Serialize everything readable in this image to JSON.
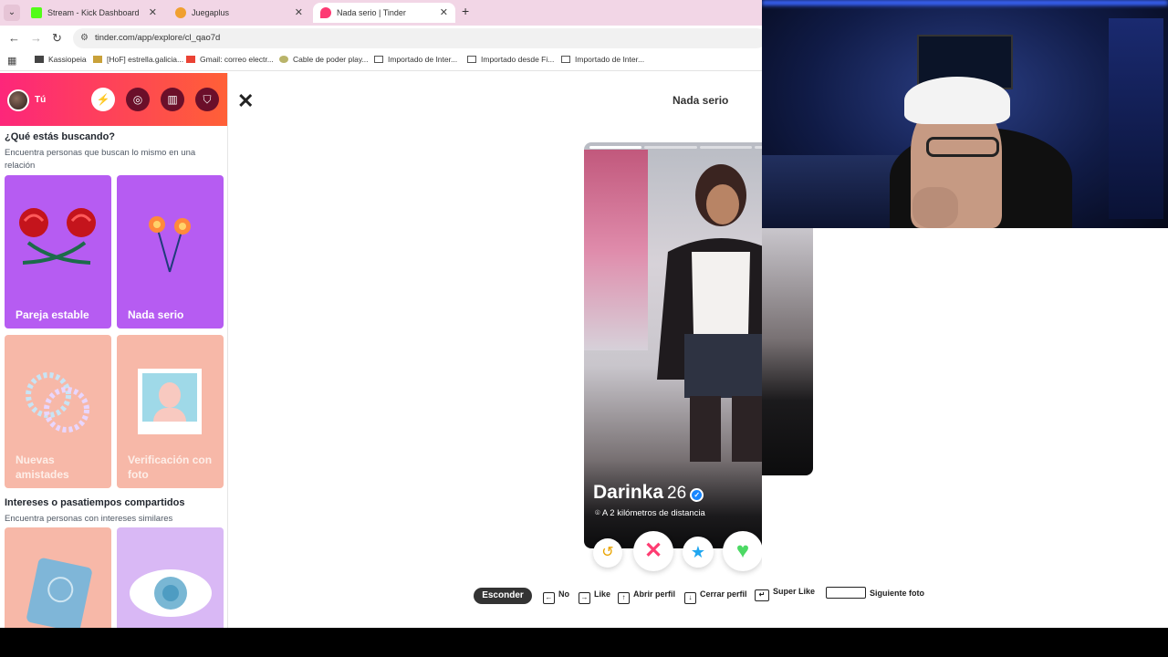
{
  "browser": {
    "tabs": [
      {
        "title": "Stream - Kick Dashboard",
        "fav_color": "#53fc18"
      },
      {
        "title": "Juegaplus",
        "fav_color": "#f0a030"
      },
      {
        "title": "Nada serio | Tinder",
        "fav_color": "#fd3a73"
      }
    ],
    "url": "tinder.com/app/explore/cl_qao7d",
    "bookmarks": [
      "Kassiopeia",
      "[HoF] estrella.galicia...",
      "Gmail: correo electr...",
      "Cable de poder play...",
      "Importado de Inter...",
      "Importado desde Fi...",
      "Importado de Inter..."
    ]
  },
  "sidebar": {
    "you_label": "Tú",
    "section1_title": "¿Qué estás buscando?",
    "section1_sub": "Encuentra personas que buscan lo mismo en una relación",
    "cards1": [
      {
        "label": "Pareja estable"
      },
      {
        "label": "Nada serio"
      },
      {
        "label": "Nuevas amistades"
      },
      {
        "label": "Verificación con foto"
      }
    ],
    "section2_title": "Intereses o pasatiempos compartidos",
    "section2_sub": "Encuentra personas con intereses similares"
  },
  "main": {
    "title": "Nada serio",
    "profile": {
      "name": "Darinka",
      "age": "26",
      "distance": "A 2 kilómetros de distancia"
    },
    "shortcuts": {
      "hide": "Esconder",
      "no": "No",
      "like": "Like",
      "open": "Abrir perfil",
      "close": "Cerrar perfil",
      "super": "Super Like",
      "next": "Siguiente foto"
    }
  },
  "colors": {
    "brand_gradient_start": "#fd267a",
    "brand_gradient_end": "#ff6036",
    "card_purple": "#b65cf2",
    "card_peach": "#f7b8a8",
    "webcam_light": "#2b55ff"
  }
}
